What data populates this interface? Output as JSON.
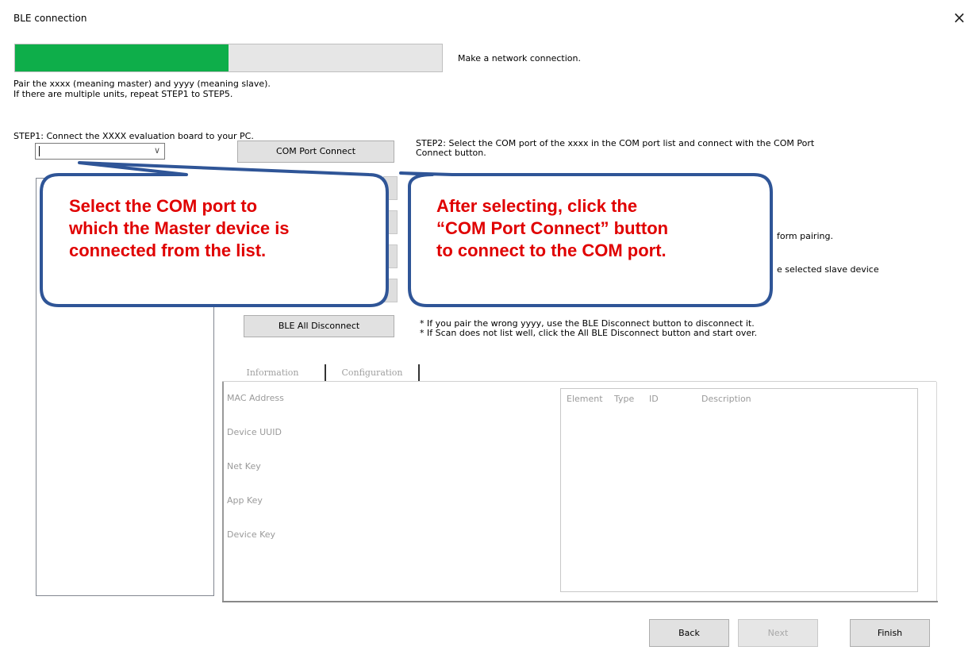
{
  "window": {
    "title": "BLE connection",
    "close_label": "×"
  },
  "progress": {
    "fraction": 0.5,
    "text": "Make a network connection.",
    "fill_color": "#0eae4a"
  },
  "intro": {
    "line1": "Pair the xxxx (meaning master) and yyyy (meaning slave).",
    "line2": "If there are multiple units, repeat STEP1 to STEP5."
  },
  "step1": {
    "label": "STEP1: Connect the XXXX evaluation board to your PC.",
    "com_port_value": ""
  },
  "step2": {
    "button_label": "COM Port Connect",
    "line1": "STEP2: Select the COM port of the xxxx in the COM port list and connect with the COM Port",
    "line2": "Connect button."
  },
  "partial_texts": {
    "step3_tail": "form pairing.",
    "step4_tail": "e selected slave device"
  },
  "ble_all_disconnect": {
    "button_label": "BLE All Disconnect",
    "note1": "* If you pair the wrong yyyy, use the BLE Disconnect button to disconnect it.",
    "note2": "* If Scan does not list well, click the All BLE Disconnect button and start over."
  },
  "tabs": [
    {
      "label": "Information"
    },
    {
      "label": "Configuration"
    }
  ],
  "info_fields": [
    {
      "label": "MAC Address"
    },
    {
      "label": "Device UUID"
    },
    {
      "label": "Net Key"
    },
    {
      "label": "App Key"
    },
    {
      "label": "Device Key"
    }
  ],
  "element_list": {
    "columns": [
      "Element",
      "Type",
      "ID",
      "Description"
    ]
  },
  "footer": {
    "back_label": "Back",
    "next_label": "Next",
    "finish_label": "Finish"
  },
  "callouts": {
    "left": {
      "line1": "Select the COM port to",
      "line2": "which the Master device is",
      "line3": "connected from the list."
    },
    "right": {
      "line1": "After selecting, click the",
      "line2": "“COM Port Connect” button",
      "line3": "to connect to the COM port."
    },
    "text_color": "#e00000",
    "border_color": "#2f5597"
  }
}
